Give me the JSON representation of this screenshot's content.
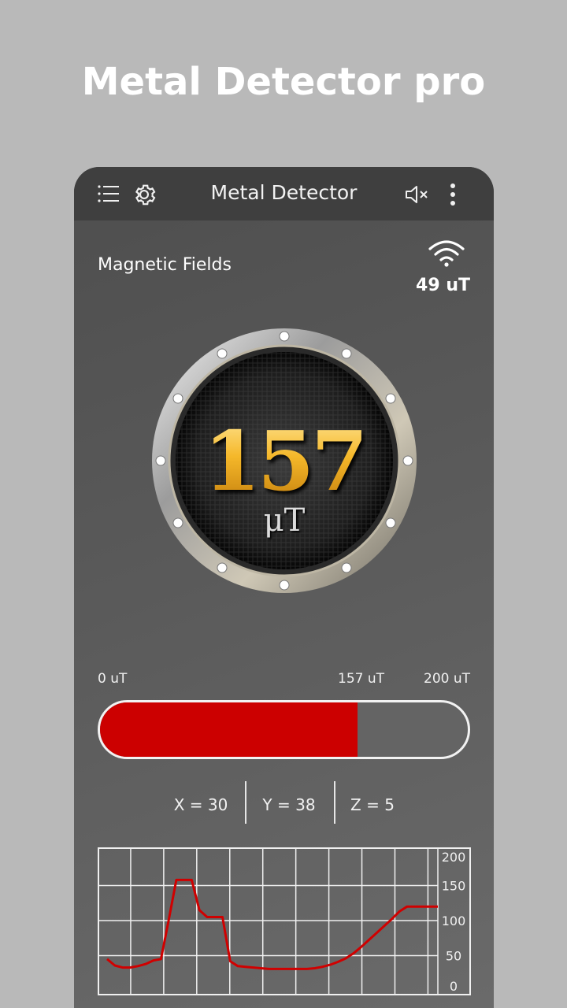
{
  "promo": {
    "title": "Metal Detector pro"
  },
  "toolbar": {
    "title": "Metal Detector",
    "icons": [
      "menu-list-icon",
      "gear-icon",
      "speaker-mute-icon",
      "more-vertical-icon"
    ]
  },
  "reading": {
    "label": "Magnetic Fields",
    "signal_value": "49 uT",
    "dial_value": "157",
    "dial_unit": "μT"
  },
  "scale": {
    "min_label": "0 uT",
    "current_label": "157 uT",
    "max_label": "200 uT",
    "fraction": 0.7,
    "fill_color": "#cc0000"
  },
  "axes": {
    "x": "X = 30",
    "y": "Y = 38",
    "z": "Z = 5"
  },
  "chart_data": {
    "type": "line",
    "ylim": [
      0,
      200
    ],
    "y_ticks": [
      "200",
      "150",
      "100",
      "50",
      "0"
    ],
    "grid": true,
    "series_color": "#d00000",
    "x": [
      0,
      1,
      2,
      3,
      4,
      5,
      6,
      7,
      8,
      9,
      10,
      11,
      12,
      13,
      14,
      15,
      16,
      17,
      18,
      19,
      20,
      21,
      22,
      23,
      24,
      25,
      26,
      27,
      28,
      29,
      30,
      31,
      32,
      33,
      34,
      35,
      36,
      37,
      38,
      39,
      40,
      41,
      42,
      43,
      44,
      45,
      46,
      47,
      48,
      49,
      50
    ],
    "values": [
      45,
      36,
      33,
      33,
      35,
      38,
      43,
      45,
      100,
      158,
      158,
      158,
      115,
      105,
      105,
      105,
      42,
      35,
      34,
      33,
      32,
      31,
      31,
      31,
      31,
      31,
      31,
      32,
      34,
      37,
      41,
      46,
      53,
      62,
      72,
      82,
      92,
      102,
      113,
      120,
      120,
      120,
      120,
      120
    ]
  }
}
